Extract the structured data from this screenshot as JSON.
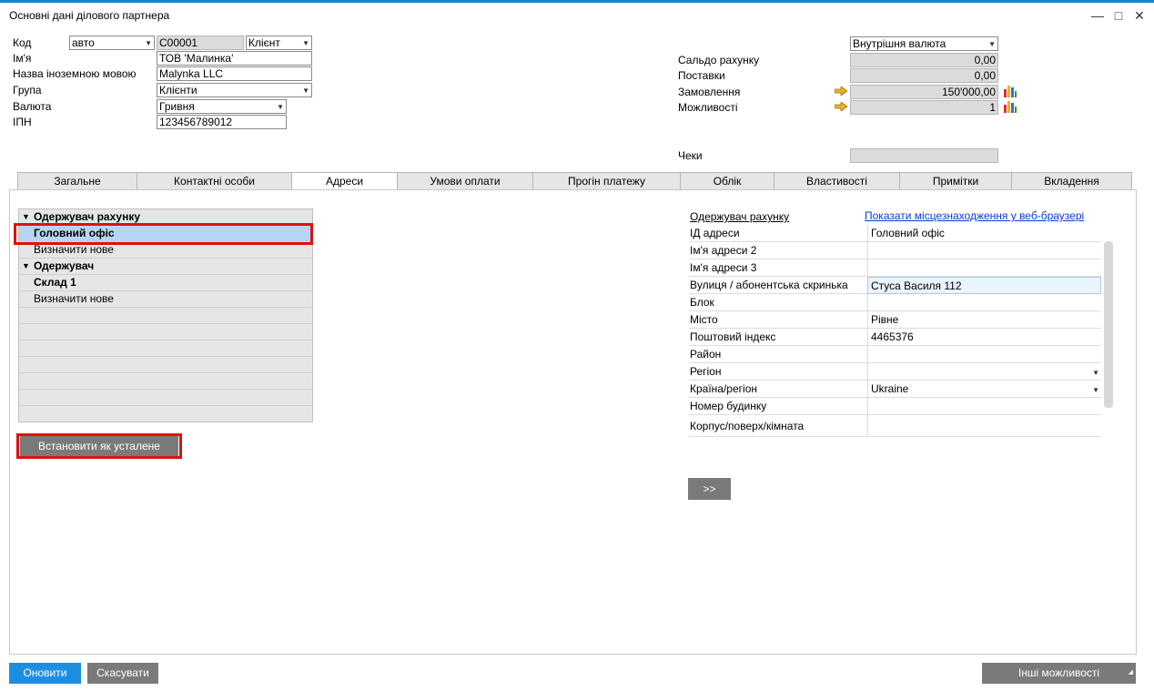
{
  "window": {
    "title": "Основні дані ділового партнера"
  },
  "header": {
    "code_label": "Код",
    "series_value": "авто",
    "code_value": "C00001",
    "type_value": "Клієнт",
    "name_label": "Ім'я",
    "name_value": "ТОВ 'Малинка'",
    "foreign_name_label": "Назва іноземною мовою",
    "foreign_name_value": "Malynka LLC",
    "group_label": "Група",
    "group_value": "Клієнти",
    "currency_label": "Валюта",
    "currency_value": "Гривня",
    "tax_label": "ІПН",
    "tax_value": "123456789012",
    "currency_mode_value": "Внутрішня валюта",
    "balance_label": "Сальдо рахунку",
    "balance_value": "0,00",
    "deliveries_label": "Поставки",
    "deliveries_value": "0,00",
    "orders_label": "Замовлення",
    "orders_value": "150'000,00",
    "opportunities_label": "Можливості",
    "opportunities_value": "1",
    "checks_label": "Чеки",
    "checks_value": ""
  },
  "tabs": [
    "Загальне",
    "Контактні особи",
    "Адреси",
    "Умови оплати",
    "Прогін платежу",
    "Облік",
    "Властивості",
    "Примітки",
    "Вкладення"
  ],
  "active_tab": "Адреси",
  "tree": {
    "bill_to_header": "Одержувач рахунку",
    "bill_to_item": "Головний офіс",
    "bill_to_new": "Визначити нове",
    "ship_to_header": "Одержувач",
    "ship_to_item": "Склад 1",
    "ship_to_new": "Визначити нове"
  },
  "set_default_button": "Встановити як усталене",
  "details": {
    "title": "Одержувач рахунку",
    "map_link": "Показати місцезнаходження у веб-браузері",
    "fields": [
      {
        "label": "ІД адреси",
        "value": "Головний офіс"
      },
      {
        "label": "Ім'я адреси 2",
        "value": ""
      },
      {
        "label": "Ім'я адреси 3",
        "value": ""
      },
      {
        "label": "Вулиця / абонентська скринька",
        "value": "Стуса Василя 112"
      },
      {
        "label": "Блок",
        "value": ""
      },
      {
        "label": "Місто",
        "value": "Рівне"
      },
      {
        "label": "Поштовий індекс",
        "value": "4465376"
      },
      {
        "label": "Район",
        "value": ""
      },
      {
        "label": "Регіон",
        "value": ""
      },
      {
        "label": "Країна/регіон",
        "value": "Ukraine"
      },
      {
        "label": "Номер будинку",
        "value": ""
      },
      {
        "label": "Корпус/поверх/кімната",
        "value": ""
      }
    ],
    "expand_button": ">>"
  },
  "footer": {
    "update_button": "Оновити",
    "cancel_button": "Скасувати",
    "more_button": "Інші можливості"
  },
  "colors": {
    "accent": "#1e8fe0",
    "highlight": "#e01010",
    "selected_row": "#b8d4f5",
    "arrow": "#f0b020"
  }
}
